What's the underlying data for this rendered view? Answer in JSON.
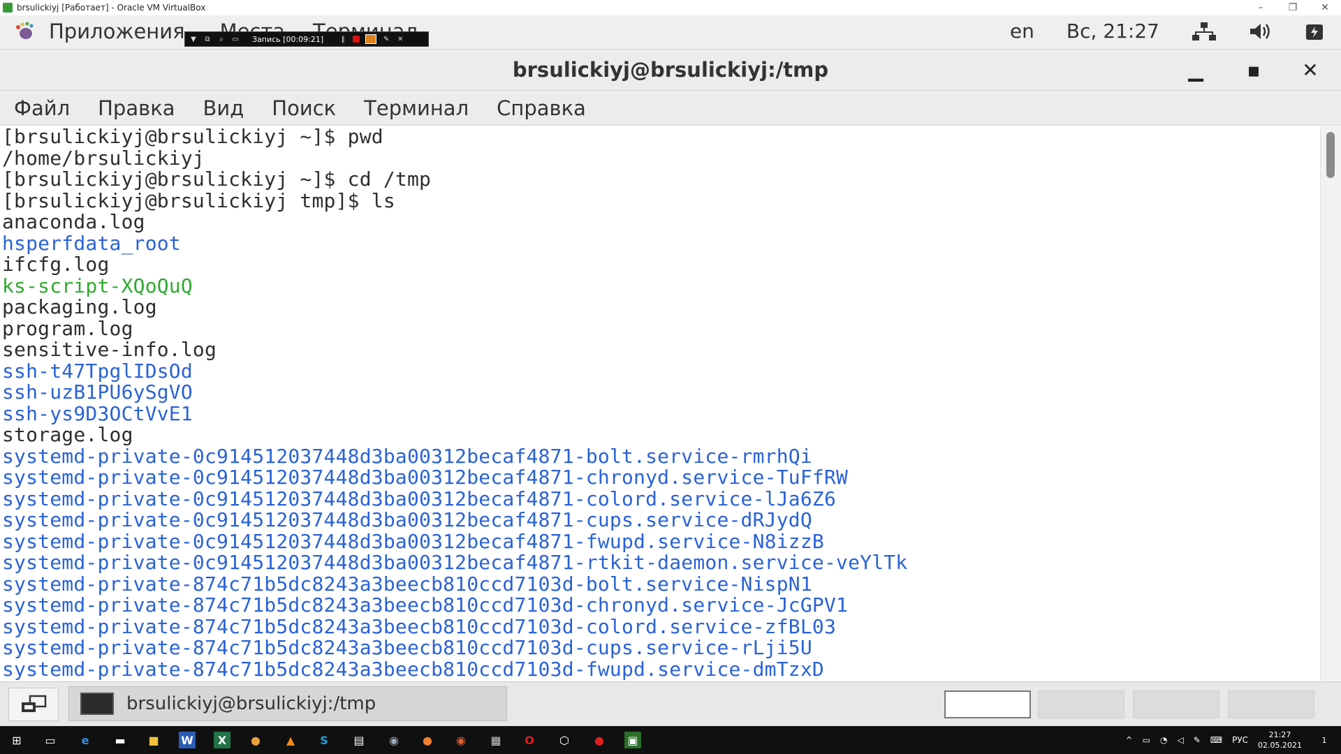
{
  "vbox": {
    "title": "brsulickiyj [Работает] - Oracle VM VirtualBox",
    "icons": [
      "virtualbox-icon",
      "minimize-icon",
      "restore-icon",
      "close-icon"
    ]
  },
  "gnome_panel": {
    "applications": "Приложения",
    "places": "Места",
    "terminal": "Терминал",
    "lang": "en",
    "clock": "Вс, 21:27",
    "icons": [
      "gnome-foot-icon",
      "network-icon",
      "volume-icon",
      "power-icon"
    ]
  },
  "recording": {
    "label": "Запись [00:09:21]",
    "icons": [
      "dropdown-icon",
      "window-icon",
      "zoom-icon",
      "region-icon",
      "pause-icon",
      "record-icon",
      "camera-icon",
      "pen-icon",
      "close-icon"
    ]
  },
  "terminal": {
    "window_title": "brsulickiyj@brsulickiyj:/tmp",
    "menu": [
      "Файл",
      "Правка",
      "Вид",
      "Поиск",
      "Терминал",
      "Справка"
    ],
    "lines": [
      {
        "text": "[brsulickiyj@brsulickiyj ~]$ pwd",
        "kind": "prompt"
      },
      {
        "text": "/home/brsulickiyj",
        "kind": "out"
      },
      {
        "text": "[brsulickiyj@brsulickiyj ~]$ cd /tmp",
        "kind": "prompt"
      },
      {
        "text": "[brsulickiyj@brsulickiyj tmp]$ ls",
        "kind": "prompt"
      },
      {
        "text": "anaconda.log",
        "kind": "file"
      },
      {
        "text": "hsperfdata_root",
        "kind": "dir"
      },
      {
        "text": "ifcfg.log",
        "kind": "file"
      },
      {
        "text": "ks-script-XQoQuQ",
        "kind": "exe"
      },
      {
        "text": "packaging.log",
        "kind": "file"
      },
      {
        "text": "program.log",
        "kind": "file"
      },
      {
        "text": "sensitive-info.log",
        "kind": "file"
      },
      {
        "text": "ssh-t47TpglIDsOd",
        "kind": "dir"
      },
      {
        "text": "ssh-uzB1PU6ySgVO",
        "kind": "dir"
      },
      {
        "text": "ssh-ys9D3OCtVvE1",
        "kind": "dir"
      },
      {
        "text": "storage.log",
        "kind": "file"
      },
      {
        "text": "systemd-private-0c914512037448d3ba00312becaf4871-bolt.service-rmrhQi",
        "kind": "dir"
      },
      {
        "text": "systemd-private-0c914512037448d3ba00312becaf4871-chronyd.service-TuFfRW",
        "kind": "dir"
      },
      {
        "text": "systemd-private-0c914512037448d3ba00312becaf4871-colord.service-lJa6Z6",
        "kind": "dir"
      },
      {
        "text": "systemd-private-0c914512037448d3ba00312becaf4871-cups.service-dRJydQ",
        "kind": "dir"
      },
      {
        "text": "systemd-private-0c914512037448d3ba00312becaf4871-fwupd.service-N8izzB",
        "kind": "dir"
      },
      {
        "text": "systemd-private-0c914512037448d3ba00312becaf4871-rtkit-daemon.service-veYlTk",
        "kind": "dir"
      },
      {
        "text": "systemd-private-874c71b5dc8243a3beecb810ccd7103d-bolt.service-NispN1",
        "kind": "dir"
      },
      {
        "text": "systemd-private-874c71b5dc8243a3beecb810ccd7103d-chronyd.service-JcGPV1",
        "kind": "dir"
      },
      {
        "text": "systemd-private-874c71b5dc8243a3beecb810ccd7103d-colord.service-zfBL03",
        "kind": "dir"
      },
      {
        "text": "systemd-private-874c71b5dc8243a3beecb810ccd7103d-cups.service-rLji5U",
        "kind": "dir"
      },
      {
        "text": "systemd-private-874c71b5dc8243a3beecb810ccd7103d-fwupd.service-dmTzxD",
        "kind": "dir"
      }
    ]
  },
  "gnome_bottom": {
    "task_label": "brsulickiyj@brsulickiyj:/tmp",
    "workspaces": 4,
    "active_workspace": 1
  },
  "windows": {
    "tray_lang": "РУС",
    "time": "21:27",
    "date": "02.05.2021",
    "notifications": "1",
    "apps": [
      "start-icon",
      "task-view-icon",
      "edge-icon",
      "cmd-icon",
      "explorer-icon",
      "word-icon",
      "excel-icon",
      "chrome-icon",
      "vlc-icon",
      "skype-icon",
      "notepad-icon",
      "steam-icon",
      "firefox-icon",
      "firefox-dev-icon",
      "files-icon",
      "opera-icon",
      "virtualbox-icon",
      "record-app-icon",
      "vbox-vm-icon"
    ]
  },
  "colors": {
    "dir": "#2a62d8",
    "exe": "#2faa2f",
    "text": "#2e2e2e"
  }
}
